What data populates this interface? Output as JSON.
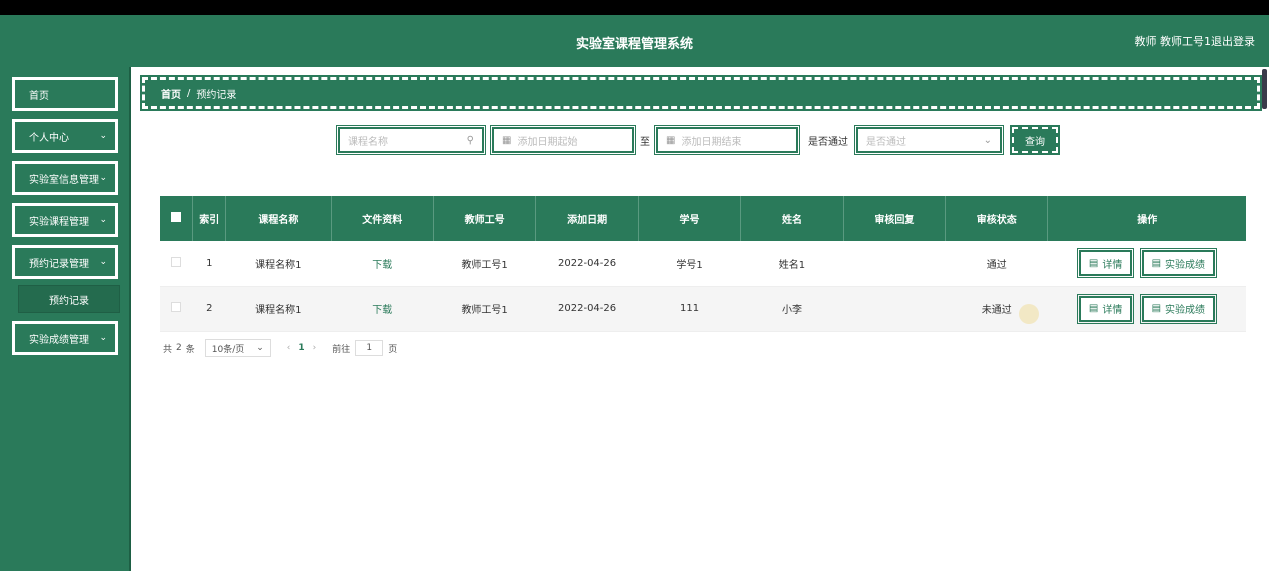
{
  "header": {
    "title": "实验室课程管理系统",
    "user": "教师 教师工号1",
    "logout": "退出登录"
  },
  "sidebar": {
    "items": [
      {
        "label": "首页",
        "chevron": false
      },
      {
        "label": "个人中心",
        "chevron": true
      },
      {
        "label": "实验室信息管理",
        "chevron": true
      },
      {
        "label": "实验课程管理",
        "chevron": true
      },
      {
        "label": "预约记录管理",
        "chevron": true
      },
      {
        "label": "实验成绩管理",
        "chevron": true
      }
    ],
    "submenu": {
      "label": "预约记录"
    }
  },
  "breadcrumb": {
    "home": "首页",
    "separator": "/",
    "current": "预约记录"
  },
  "filters": {
    "course_placeholder": "课程名称",
    "date_start_placeholder": "添加日期起始",
    "to_label": "至",
    "date_end_placeholder": "添加日期结束",
    "passed_label": "是否通过",
    "passed_placeholder": "是否通过",
    "query_label": "查询"
  },
  "table": {
    "headers": [
      "索引",
      "课程名称",
      "文件资料",
      "教师工号",
      "添加日期",
      "学号",
      "姓名",
      "审核回复",
      "审核状态",
      "操作"
    ],
    "rows": [
      {
        "index": "1",
        "course": "课程名称1",
        "file": "下载",
        "teacher_id": "教师工号1",
        "date": "2022-04-26",
        "student_id": "学号1",
        "name": "姓名1",
        "reply": "",
        "status": "通过"
      },
      {
        "index": "2",
        "course": "课程名称1",
        "file": "下载",
        "teacher_id": "教师工号1",
        "date": "2022-04-26",
        "student_id": "111",
        "name": "小李",
        "reply": "",
        "status": "未通过"
      }
    ],
    "detail_label": "详情",
    "score_label": "实验成绩"
  },
  "pager": {
    "total_prefix": "共",
    "total": "2",
    "total_suffix": "条",
    "page_size": "10条/页",
    "current_page": "1",
    "goto_label": "前往",
    "goto_value": "1",
    "goto_suffix": "页"
  },
  "colors": {
    "primary": "#2a7a5a"
  }
}
